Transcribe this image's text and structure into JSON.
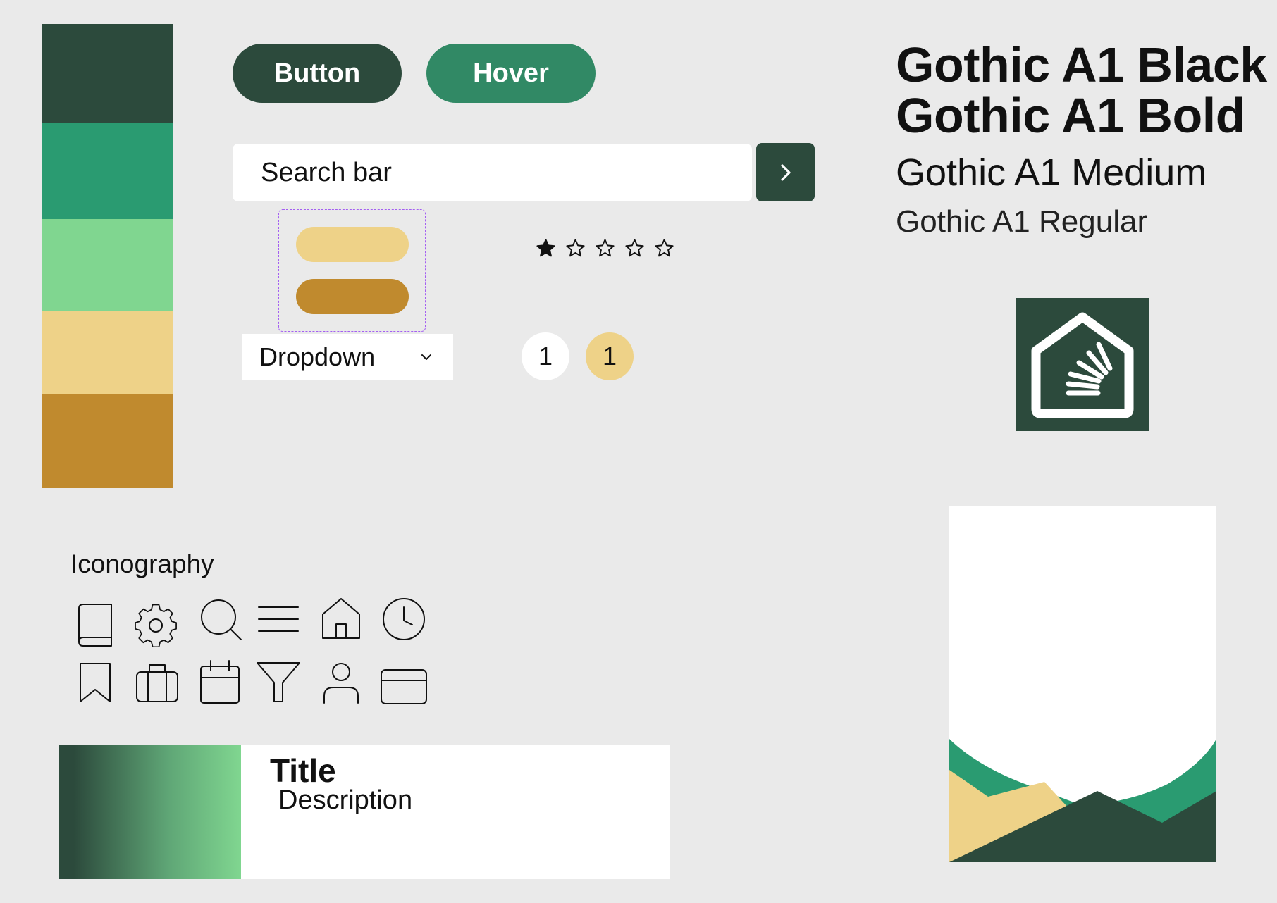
{
  "palette": {
    "swatches": [
      {
        "name": "dark-green",
        "color": "#2c4a3c"
      },
      {
        "name": "green",
        "color": "#2a9b71"
      },
      {
        "name": "light-green",
        "color": "#80d690"
      },
      {
        "name": "light-yellow",
        "color": "#eed288"
      },
      {
        "name": "ochre",
        "color": "#c08a2e"
      }
    ]
  },
  "buttons": {
    "default_label": "Button",
    "hover_label": "Hover"
  },
  "search": {
    "placeholder": "Search bar",
    "submit_icon": "chevron-right-icon"
  },
  "rating": {
    "value": 1,
    "max": 5
  },
  "dropdown": {
    "label": "Dropdown",
    "icon": "chevron-down-icon"
  },
  "pagination": {
    "page_default": "1",
    "page_active": "1"
  },
  "typography": {
    "black": "Gothic A1 Black",
    "bold": "Gothic A1 Bold",
    "medium": "Gothic A1 Medium",
    "regular": "Gothic A1 Regular"
  },
  "logo": {
    "icon": "house-stack-logo"
  },
  "iconography": {
    "heading": "Iconography",
    "icons": [
      "book-icon",
      "gear-icon",
      "search-icon",
      "menu-icon",
      "home-icon",
      "clock-icon",
      "bookmark-icon",
      "briefcase-icon",
      "calendar-icon",
      "filter-icon",
      "user-icon",
      "credit-card-icon"
    ]
  },
  "card": {
    "title": "Title",
    "description": "Description"
  },
  "colors": {
    "background": "#eaeaea",
    "primary": "#2c4a3c",
    "hover": "#318965",
    "accent": "#eed288",
    "selection_outline": "#a45ff2"
  }
}
